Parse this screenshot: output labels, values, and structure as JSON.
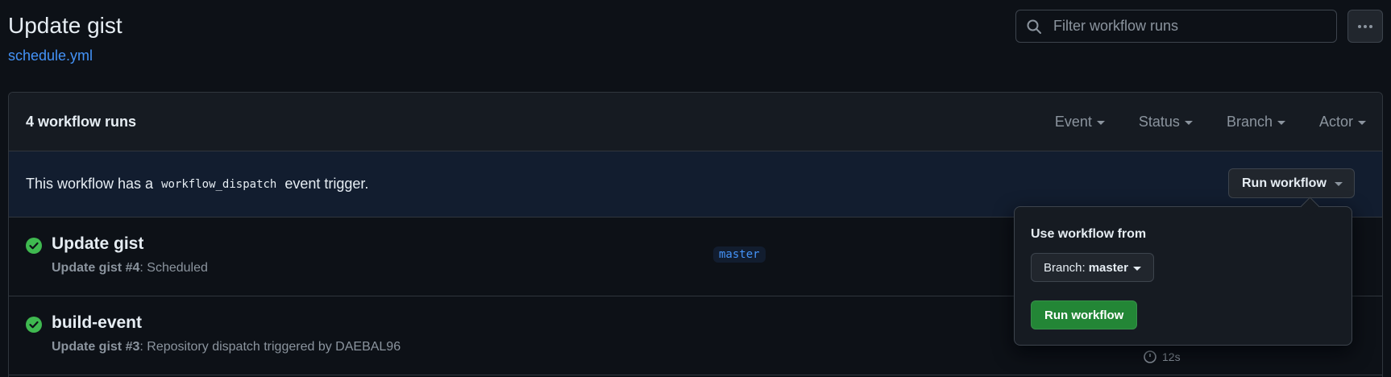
{
  "header": {
    "title": "Update gist",
    "workflow_file": "schedule.yml",
    "search_placeholder": "Filter workflow runs"
  },
  "runs_box": {
    "count_label": "4 workflow runs",
    "filters": [
      "Event",
      "Status",
      "Branch",
      "Actor"
    ]
  },
  "dispatch_banner": {
    "text_before": "This workflow has a",
    "code": "workflow_dispatch",
    "text_after": "event trigger.",
    "run_button_label": "Run workflow"
  },
  "runs": [
    {
      "title": "Update gist",
      "workflow_name": "Update gist",
      "run_number": "#4",
      "detail": ": Scheduled",
      "branch": "master",
      "status": "success"
    },
    {
      "title": "build-event",
      "workflow_name": "Update gist",
      "run_number": "#3",
      "detail": ": Repository dispatch triggered by DAEBAL96",
      "duration": "12s",
      "status": "success"
    }
  ],
  "run_popover": {
    "label": "Use workflow from",
    "branch_prefix": "Branch:",
    "branch_value": "master",
    "submit_label": "Run workflow"
  },
  "colors": {
    "background": "#0d1117",
    "link": "#4493f8",
    "success": "#3fb950",
    "primary_button": "#238636"
  }
}
